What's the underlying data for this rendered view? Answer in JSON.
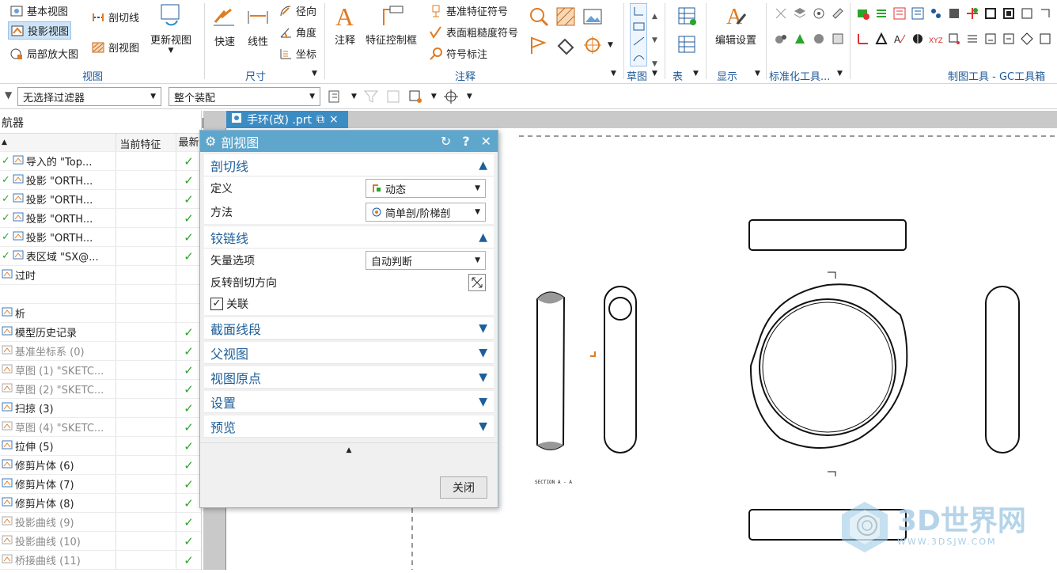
{
  "ribbon": {
    "view_group": {
      "items": [
        "基本视图",
        "投影视图",
        "局部放大图"
      ],
      "section_cut": "剖切线",
      "section_view": "剖视图",
      "update_view": "更新视图",
      "label": "视图"
    },
    "dimension_group": {
      "quick": "快速",
      "linear": "线性",
      "radial": "径向",
      "angular": "角度",
      "coordinate": "坐标",
      "label": "尺寸"
    },
    "annotation_group": {
      "note": "注释",
      "fcf": "特征控制框",
      "datum": "基准特征符号",
      "surface": "表面粗糙度符号",
      "symbol": "符号标注",
      "label": "注释"
    },
    "sketch_label": "草图",
    "table_label": "表",
    "display_group": {
      "edit_settings": "编辑设置",
      "label": "显示"
    },
    "std_tools_label": "标准化工具...",
    "gc_tools_label": "制图工具 - GC工具箱"
  },
  "toolbar2": {
    "filter": "无选择过滤器",
    "scope": "整个装配"
  },
  "navigator": {
    "title": "航器",
    "col_current": "当前特征",
    "col_latest": "最新",
    "rows": [
      {
        "label": "导入的 \"Top...",
        "check": "✓",
        "gray": false,
        "prefix": "✓"
      },
      {
        "label": "投影 \"ORTH...",
        "check": "✓",
        "gray": false,
        "prefix": "✓"
      },
      {
        "label": "投影 \"ORTH...",
        "check": "✓",
        "gray": false,
        "prefix": "✓"
      },
      {
        "label": "投影 \"ORTH...",
        "check": "✓",
        "gray": false,
        "prefix": "✓"
      },
      {
        "label": "投影 \"ORTH...",
        "check": "✓",
        "gray": false,
        "prefix": "✓"
      },
      {
        "label": "表区域 \"SX@...",
        "check": "✓",
        "gray": false,
        "prefix": "✓"
      },
      {
        "label": "过时",
        "check": "",
        "gray": false,
        "prefix": ""
      },
      {
        "label": "",
        "check": "",
        "gray": false,
        "prefix": ""
      },
      {
        "label": "析",
        "check": "",
        "gray": false,
        "prefix": ""
      },
      {
        "label": "模型历史记录",
        "check": "✓",
        "gray": false,
        "prefix": ""
      },
      {
        "label": "基准坐标系 (0)",
        "check": "✓",
        "gray": true,
        "prefix": ""
      },
      {
        "label": "草图 (1) \"SKETC...",
        "check": "✓",
        "gray": true,
        "prefix": ""
      },
      {
        "label": "草图 (2) \"SKETC...",
        "check": "✓",
        "gray": true,
        "prefix": ""
      },
      {
        "label": "扫掠 (3)",
        "check": "✓",
        "gray": false,
        "prefix": ""
      },
      {
        "label": "草图 (4) \"SKETC...",
        "check": "✓",
        "gray": true,
        "prefix": ""
      },
      {
        "label": "拉伸 (5)",
        "check": "✓",
        "gray": false,
        "prefix": ""
      },
      {
        "label": "修剪片体 (6)",
        "check": "✓",
        "gray": false,
        "prefix": ""
      },
      {
        "label": "修剪片体 (7)",
        "check": "✓",
        "gray": false,
        "prefix": ""
      },
      {
        "label": "修剪片体 (8)",
        "check": "✓",
        "gray": false,
        "prefix": ""
      },
      {
        "label": "投影曲线 (9)",
        "check": "✓",
        "gray": true,
        "prefix": ""
      },
      {
        "label": "投影曲线 (10)",
        "check": "✓",
        "gray": true,
        "prefix": ""
      },
      {
        "label": "桥接曲线 (11)",
        "check": "✓",
        "gray": true,
        "prefix": ""
      }
    ]
  },
  "tab": {
    "title": "手环(改) .prt"
  },
  "dialog": {
    "title": "剖视图",
    "sec_cutline": "剖切线",
    "define_label": "定义",
    "define_value": "动态",
    "method_label": "方法",
    "method_value": "简单剖/阶梯剖",
    "sec_hinge": "铰链线",
    "vector_label": "矢量选项",
    "vector_value": "自动判断",
    "reverse_label": "反转剖切方向",
    "assoc_label": "关联",
    "collapsed": [
      "截面线段",
      "父视图",
      "视图原点",
      "设置",
      "预览"
    ],
    "close": "关闭"
  },
  "drawing": {
    "section_label": "SECTION A - A"
  },
  "watermark": {
    "brand": "3D世界网",
    "url": "WWW.3DSJW.COM"
  }
}
